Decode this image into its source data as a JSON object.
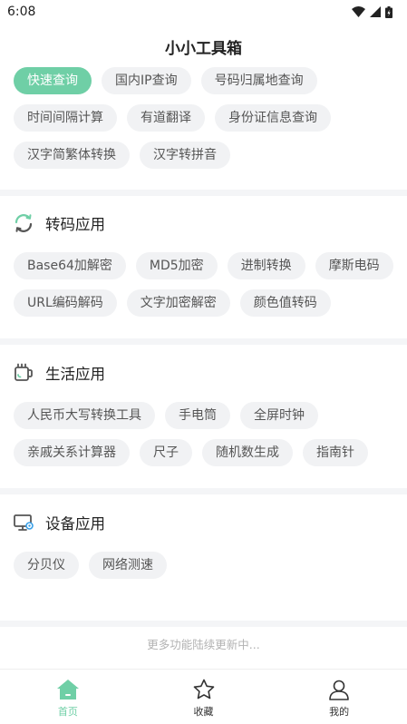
{
  "status": {
    "time": "6:08"
  },
  "header": {
    "title": "小小工具箱"
  },
  "query": {
    "rows": [
      [
        "快速查询",
        "国内IP查询",
        "号码归属地查询"
      ],
      [
        "时间间隔计算",
        "有道翻译",
        "身份证信息查询"
      ],
      [
        "汉字简繁体转换",
        "汉字转拼音"
      ]
    ]
  },
  "transcode": {
    "title": "转码应用",
    "icon": "refresh-icon",
    "rows": [
      [
        "Base64加解密",
        "MD5加密",
        "进制转换",
        "摩斯电码"
      ],
      [
        "URL编码解码",
        "文字加密解密",
        "颜色值转码"
      ]
    ]
  },
  "life": {
    "title": "生活应用",
    "icon": "cup-icon",
    "rows": [
      [
        "人民币大写转换工具",
        "手电筒",
        "全屏时钟"
      ],
      [
        "亲戚关系计算器",
        "尺子",
        "随机数生成",
        "指南针"
      ]
    ]
  },
  "device": {
    "title": "设备应用",
    "icon": "monitor-icon",
    "rows": [
      [
        "分贝仪",
        "网络测速"
      ]
    ]
  },
  "footer": {
    "note": "更多功能陆续更新中..."
  },
  "tabs": [
    {
      "label": "首页",
      "icon": "home-icon",
      "active": true
    },
    {
      "label": "收藏",
      "icon": "star-icon",
      "active": false
    },
    {
      "label": "我的",
      "icon": "user-icon",
      "active": false
    }
  ],
  "colors": {
    "accent": "#6fcfa6",
    "chip_bg": "#f1f2f4",
    "divider": "#f4f5f7"
  }
}
